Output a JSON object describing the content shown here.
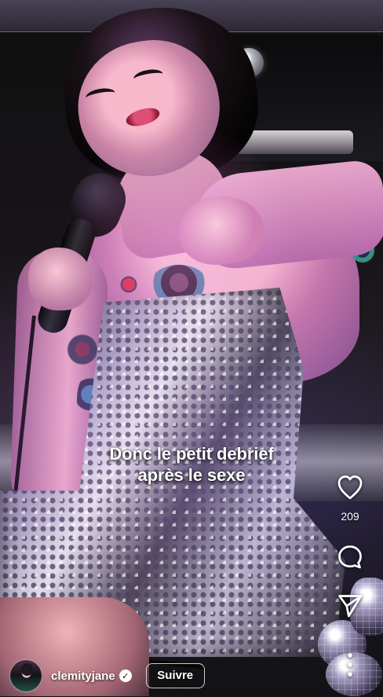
{
  "post": {
    "caption_line_1": "Donc le petit debrief",
    "caption_line_2": "après le sexe",
    "username": "clemityjane",
    "follow_label": "Suivre",
    "likes": "209"
  },
  "icons": {
    "like": "heart-icon",
    "comment": "comment-icon",
    "share": "send-icon",
    "more": "more-vertical-icon",
    "verified": "verified-icon"
  },
  "colors": {
    "text": "#ffffff",
    "button_border": "#ffffff",
    "overlay_shadow": "#000000"
  }
}
